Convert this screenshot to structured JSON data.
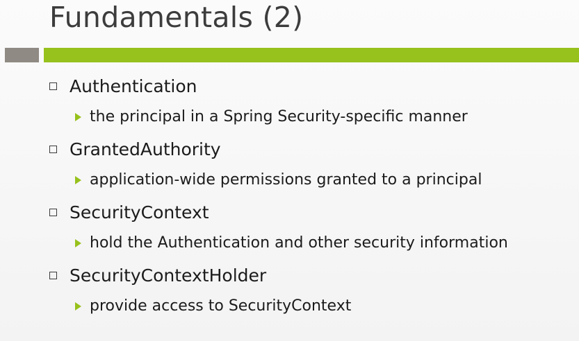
{
  "slide": {
    "title": "Fundamentals (2)",
    "items": [
      {
        "term": "Authentication",
        "description": "the principal in a Spring Security-specific manner"
      },
      {
        "term": "GrantedAuthority",
        "description": "application-wide permissions granted to a principal"
      },
      {
        "term": "SecurityContext",
        "description": "hold the Authentication and other security information"
      },
      {
        "term": "SecurityContextHolder",
        "description": "provide access to SecurityContext"
      }
    ],
    "colors": {
      "accent_green": "#97c11c",
      "accent_gray": "#8f8a83",
      "title_text": "#3c3c3c"
    },
    "icons": {
      "level1_bullet": "square-bullet-icon",
      "level2_bullet": "arrow-bullet-icon"
    }
  }
}
